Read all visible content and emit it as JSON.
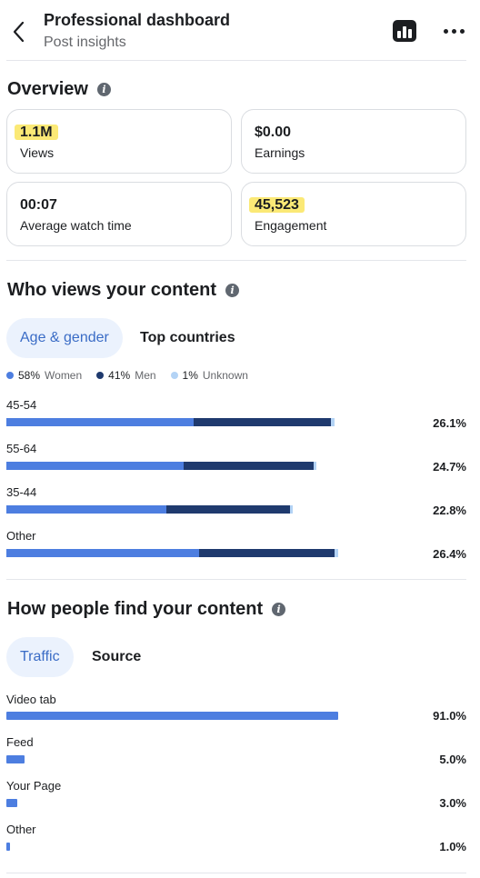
{
  "header": {
    "title": "Professional dashboard",
    "subtitle": "Post insights"
  },
  "overview": {
    "title": "Overview",
    "cards": [
      {
        "value": "1.1M",
        "label": "Views",
        "highlighted": true
      },
      {
        "value": "$0.00",
        "label": "Earnings",
        "highlighted": false
      },
      {
        "value": "00:07",
        "label": "Average watch time",
        "highlighted": false
      },
      {
        "value": "45,523",
        "label": "Engagement",
        "highlighted": true
      }
    ]
  },
  "audience": {
    "title": "Who views your content",
    "tabs": [
      {
        "label": "Age & gender",
        "active": true
      },
      {
        "label": "Top countries",
        "active": false
      }
    ],
    "legend": [
      {
        "pct": "58%",
        "label": "Women",
        "color": "#4d7ee0"
      },
      {
        "pct": "41%",
        "label": "Men",
        "color": "#1f3a6e"
      },
      {
        "pct": "1%",
        "label": "Unknown",
        "color": "#b3d3f5"
      }
    ],
    "rows": [
      {
        "label": "45-54",
        "value": "26.1%",
        "women": 0.57,
        "men": 0.42,
        "unknown": 0.01
      },
      {
        "label": "55-64",
        "value": "24.7%",
        "women": 0.57,
        "men": 0.42,
        "unknown": 0.01
      },
      {
        "label": "35-44",
        "value": "22.8%",
        "women": 0.56,
        "men": 0.43,
        "unknown": 0.01
      },
      {
        "label": "Other",
        "value": "26.4%",
        "women": 0.58,
        "men": 0.41,
        "unknown": 0.01
      }
    ]
  },
  "discovery": {
    "title": "How people find your content",
    "tabs": [
      {
        "label": "Traffic",
        "active": true
      },
      {
        "label": "Source",
        "active": false
      }
    ],
    "rows": [
      {
        "label": "Video tab",
        "value": "91.0%",
        "fraction": 0.91
      },
      {
        "label": "Feed",
        "value": "5.0%",
        "fraction": 0.05
      },
      {
        "label": "Your Page",
        "value": "3.0%",
        "fraction": 0.03
      },
      {
        "label": "Other",
        "value": "1.0%",
        "fraction": 0.01
      }
    ]
  },
  "colors": {
    "women": "#4d7ee0",
    "men": "#1f3a6e",
    "unknown": "#b3d3f5",
    "traffic_bar": "#4d7ee0",
    "highlight": "#fbe976",
    "accent": "#3a6cc6"
  },
  "icons": {
    "back": "chevron-left-icon",
    "chart": "bar-chart-icon",
    "more": "more-horizontal-icon",
    "info": "info-icon"
  }
}
